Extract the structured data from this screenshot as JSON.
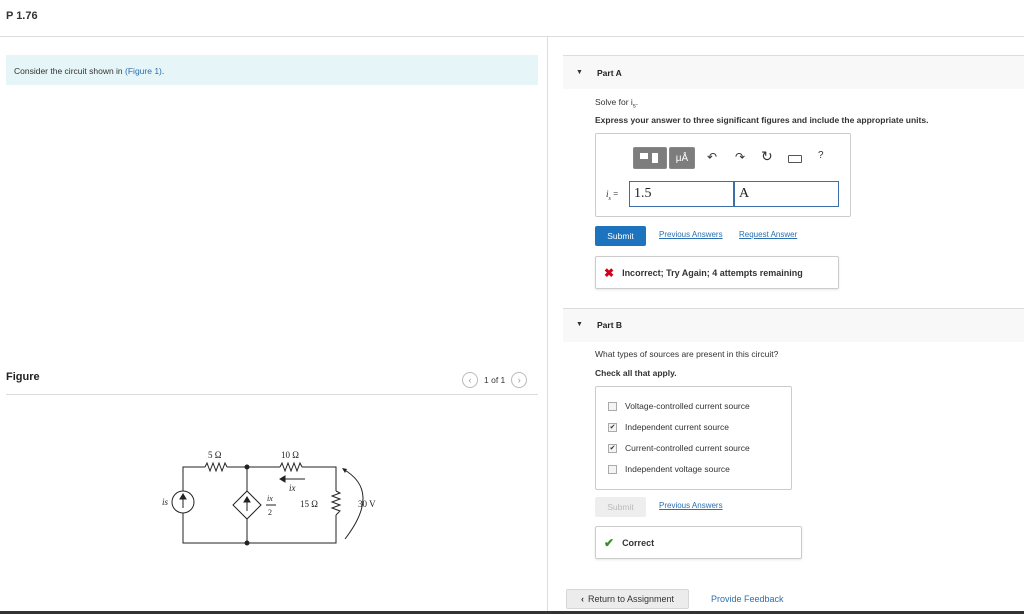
{
  "page": {
    "title": "P 1.76"
  },
  "intro": {
    "text": "Consider the circuit shown in ",
    "link": "(Figure 1)",
    "tail": "."
  },
  "figure": {
    "label": "Figure",
    "pager": "1 of 1",
    "circuit": {
      "r1": "5 Ω",
      "r2": "10 Ω",
      "r3": "15 Ω",
      "v": "30 V",
      "is_label": "is",
      "ix_label": "ix",
      "dep_num": "ix",
      "dep_den": "2"
    }
  },
  "partA": {
    "header": "Part A",
    "prompt": "Solve for i",
    "prompt_sub": "s",
    "instruction": "Express your answer to three significant figures and include the appropriate units.",
    "toolbar": {
      "units_label": "μÅ",
      "help": "?"
    },
    "var_label": "i",
    "var_sub": "s",
    "eq": " =",
    "value": "1.5",
    "unit": "A",
    "submit_label": "Submit",
    "previous_answers": "Previous Answers",
    "request_answer": "Request Answer",
    "feedback": "Incorrect; Try Again; 4 attempts remaining"
  },
  "partB": {
    "header": "Part B",
    "question": "What types of sources are present in this circuit?",
    "instruction": "Check all that apply.",
    "options": [
      {
        "label": "Voltage-controlled current source",
        "checked": false
      },
      {
        "label": "Independent current source",
        "checked": true
      },
      {
        "label": "Current-controlled current source",
        "checked": true
      },
      {
        "label": "Independent voltage source",
        "checked": false
      }
    ],
    "submit_label": "Submit",
    "previous_answers": "Previous Answers",
    "feedback": "Correct"
  },
  "footer": {
    "return_label": "Return to Assignment",
    "provide_feedback": "Provide Feedback"
  },
  "colors": {
    "accent": "#1e73be",
    "link": "#2a6fb0",
    "incorrect": "#d0021b",
    "correct": "#3c8c2c"
  }
}
